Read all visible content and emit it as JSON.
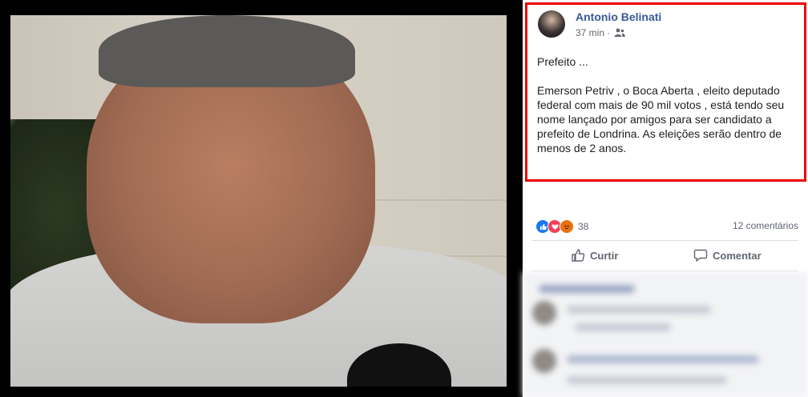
{
  "post": {
    "author": "Antonio Belinati",
    "time": "37 min",
    "separator": "·",
    "paragraph1": "Prefeito ...",
    "paragraph2": "Emerson Petriv , o Boca Aberta , eleito deputado federal com mais de 90 mil votos , está tendo seu nome lançado por amigos para ser candidato a prefeito de Londrina. As eleições serão dentro de menos de 2 anos.",
    "highlight_color": "#ee0000"
  },
  "engagement": {
    "reactions": [
      "like-icon",
      "love-icon",
      "angry-icon"
    ],
    "reaction_count": "38",
    "comment_count": "12 comentários"
  },
  "actions": {
    "like_label": "Curtir",
    "comment_label": "Comentar"
  },
  "colors": {
    "author_link": "#385898",
    "like": "#1877f2",
    "love": "#f33e58",
    "angry": "#e9710f"
  }
}
